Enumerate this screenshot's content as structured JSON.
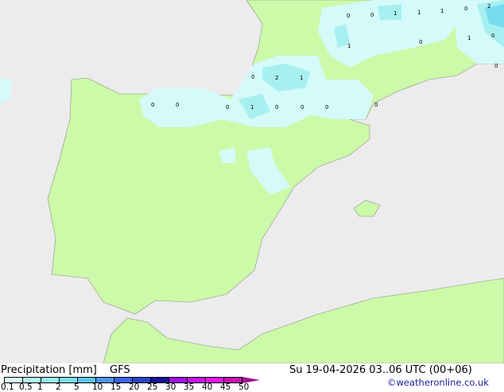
{
  "map": {
    "colors": {
      "sea": "#ececec",
      "land": "#ccfaa8",
      "precip_light": "#d4fafa",
      "precip_mid": "#a8f0f0",
      "precip_high": "#78dcf0",
      "border": "#8c8c8c"
    },
    "labels": [
      {
        "text": "0"
      },
      {
        "text": "0"
      },
      {
        "text": "1"
      },
      {
        "text": "1"
      },
      {
        "text": "1"
      },
      {
        "text": "0"
      },
      {
        "text": "2"
      },
      {
        "text": "1"
      },
      {
        "text": "1"
      },
      {
        "text": "0"
      },
      {
        "text": "0"
      },
      {
        "text": "0"
      },
      {
        "text": "2"
      },
      {
        "text": "1"
      },
      {
        "text": "0"
      },
      {
        "text": "0"
      },
      {
        "text": "0"
      },
      {
        "text": "1"
      },
      {
        "text": "0"
      },
      {
        "text": "0"
      },
      {
        "text": "0"
      },
      {
        "text": "0"
      },
      {
        "text": "0"
      }
    ]
  },
  "legend": {
    "title": "Precipitation [mm]",
    "model": "GFS",
    "datetime": "Su 19-04-2026 03..06 UTC (00+06)",
    "credit": "©weatheronline.co.uk",
    "ticks": [
      "0.1",
      "0.5",
      "1",
      "2",
      "5",
      "10",
      "15",
      "20",
      "25",
      "30",
      "35",
      "40",
      "45",
      "50"
    ],
    "colorbar": [
      "#dcfcfc",
      "#b4f8f8",
      "#96f0f0",
      "#78e0f0",
      "#5ac8f0",
      "#5096f0",
      "#3c64f0",
      "#2846c8",
      "#14149b",
      "#a014f0",
      "#c814f0",
      "#f014f0",
      "#c814b4"
    ],
    "overflow_color": "#a0148c"
  }
}
